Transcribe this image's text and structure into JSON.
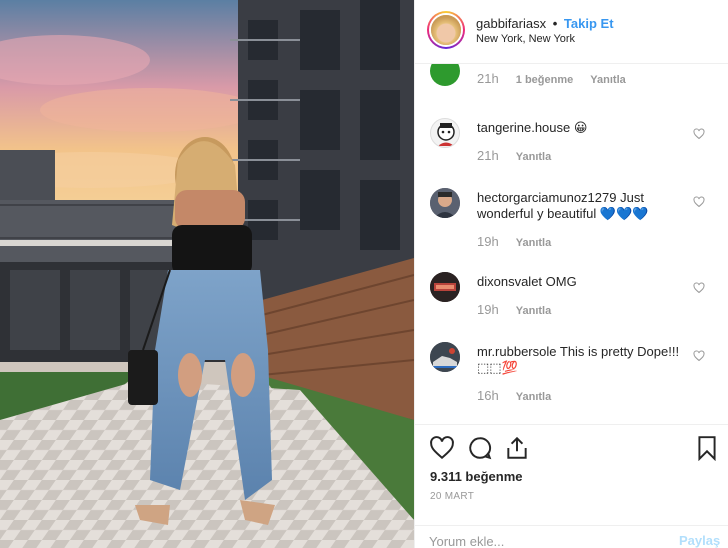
{
  "header": {
    "username": "gabbifariasx",
    "separator": "•",
    "follow_label": "Takip Et",
    "location": "New York, New York"
  },
  "comments": [
    {
      "username": "",
      "text": "",
      "time": "21h",
      "likes": "1 beğenme",
      "reply": "Yanıtla",
      "avatar": "green-avatar"
    },
    {
      "username": "tangerine.house",
      "text": "😀",
      "time": "21h",
      "reply": "Yanıtla",
      "avatar": "cartoon-avatar"
    },
    {
      "username": "hectorgarciamunoz1279",
      "text": "Just wonderful y beautiful 💙💙💙",
      "time": "19h",
      "reply": "Yanıtla",
      "avatar": "man-avatar"
    },
    {
      "username": "dixonsvalet",
      "text": "OMG",
      "time": "19h",
      "reply": "Yanıtla",
      "avatar": "sign-avatar"
    },
    {
      "username": "mr.rubbersole",
      "text": "This is pretty Dope!!! ⬚⬚💯",
      "time": "16h",
      "reply": "Yanıtla",
      "avatar": "shoe-avatar"
    }
  ],
  "actions": {
    "likes": "9.311 beğenme",
    "date": "20 MART",
    "comment_placeholder": "Yorum ekle...",
    "post_label": "Paylaş"
  },
  "colors": {
    "accent": "#3897f0",
    "muted": "#999999",
    "post_disabled": "#b2dffc"
  }
}
